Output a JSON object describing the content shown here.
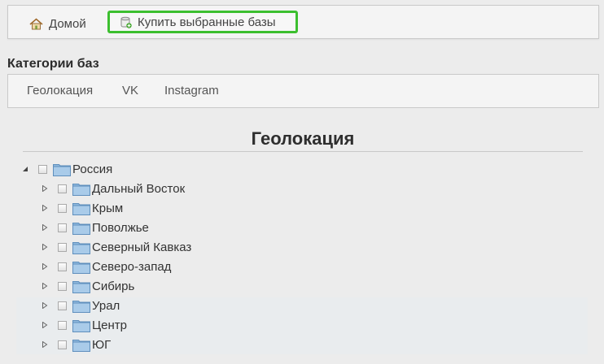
{
  "toolbar": {
    "home_label": "Домой",
    "buy_label": "Купить выбранные базы"
  },
  "categories": {
    "title": "Категории баз",
    "items": [
      "Геолокация",
      "VK",
      "Instagram"
    ]
  },
  "panel": {
    "title": "Геолокация"
  },
  "tree": {
    "root": {
      "label": "Россия",
      "expanded": true,
      "checked": false
    },
    "children": [
      {
        "label": "Дальный Восток",
        "checked": false
      },
      {
        "label": "Крым",
        "checked": false
      },
      {
        "label": "Поволжье",
        "checked": false
      },
      {
        "label": "Северный Кавказ",
        "checked": false
      },
      {
        "label": "Северо-запад",
        "checked": false
      },
      {
        "label": "Сибирь",
        "checked": false
      },
      {
        "label": "Урал",
        "checked": false
      },
      {
        "label": "Центр",
        "checked": false
      },
      {
        "label": "ЮГ",
        "checked": false
      }
    ]
  },
  "icons": {
    "home": "home-icon",
    "buy": "database-add-icon",
    "folder": "folder-icon",
    "expanded": "triangle-down-icon",
    "collapsed": "triangle-right-icon"
  },
  "colors": {
    "accent": "#3cbf2f",
    "folder": "#8fb8dd"
  }
}
